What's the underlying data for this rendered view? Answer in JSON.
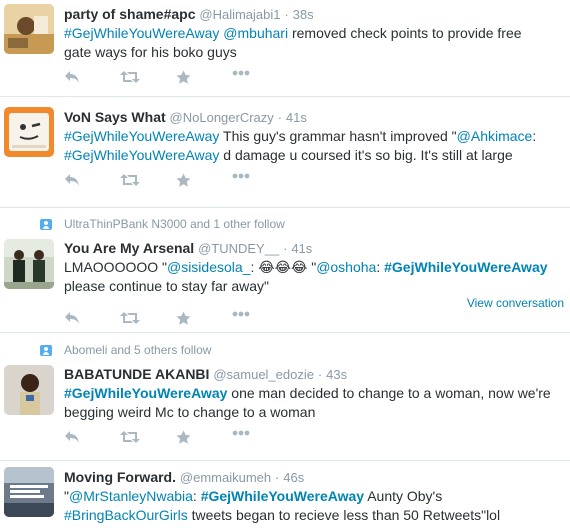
{
  "tweets": [
    {
      "name": "party of shame#apc",
      "handle": "@Halimajabi1",
      "time": "38s",
      "text_parts": [
        {
          "t": "#GejWhileYouWereAway",
          "k": "hashtag"
        },
        {
          "t": " ",
          "k": "text"
        },
        {
          "t": "@mbuhari",
          "k": "mention"
        },
        {
          "t": " removed check points to provide free",
          "k": "text"
        }
      ],
      "line2": "gate ways for his boko guys"
    },
    {
      "name": "VoN Says What",
      "handle": "@NoLongerCrazy",
      "time": "41s",
      "line1_a": "#GejWhileYouWereAway",
      "line1_b": " This guy's grammar hasn't improved \"",
      "line1_c": "@Ahkimace",
      "line1_d": ":",
      "line2_a": "#GejWhileYouWereAway",
      "line2_b": " d damage u coursed it's so big. It's still at large"
    },
    {
      "context": "UltraThinPBank N3000 and 1 other follow",
      "name": "You Are My Arsenal",
      "handle": "@TUNDEY__",
      "time": "41s",
      "line1_a": "LMAOOOOOO \"",
      "line1_b": "@sisidesola_",
      "line1_c": ": 😂😂😂 \"",
      "line1_d": "@oshoha",
      "line1_e": ": ",
      "line1_f": "#GejWhileYouWereAway",
      "line2": "please continue to stay far away\"",
      "view_conversation": "View conversation"
    },
    {
      "context": "Abomeli and 5 others follow",
      "name": "BABATUNDE AKANBI",
      "handle": "@samuel_edozie",
      "time": "43s",
      "line1_a": "#GejWhileYouWereAway",
      "line1_b": " one man decided to change to a woman, now we're",
      "line2": "begging weird Mc to change to a woman"
    },
    {
      "name": "Moving Forward.",
      "handle": "@emmaikumeh",
      "time": "46s",
      "line1_a": "\"",
      "line1_b": "@MrStanleyNwabia",
      "line1_c": ": ",
      "line1_d": "#GejWhileYouWereAway",
      "line1_e": " Aunty Oby's",
      "line2_a": "#BringBackOurGirls",
      "line2_b": " tweets began to recieve less than 50 Retweets\"lol"
    }
  ],
  "separator": "·",
  "icons": [
    "reply-icon",
    "retweet-icon",
    "favorite-icon",
    "more-icon"
  ],
  "colors": {
    "link": "#0084b4",
    "meta": "#8899a6",
    "text": "#292f33",
    "icon": "#aab8c2",
    "border": "#e1e8ed"
  }
}
